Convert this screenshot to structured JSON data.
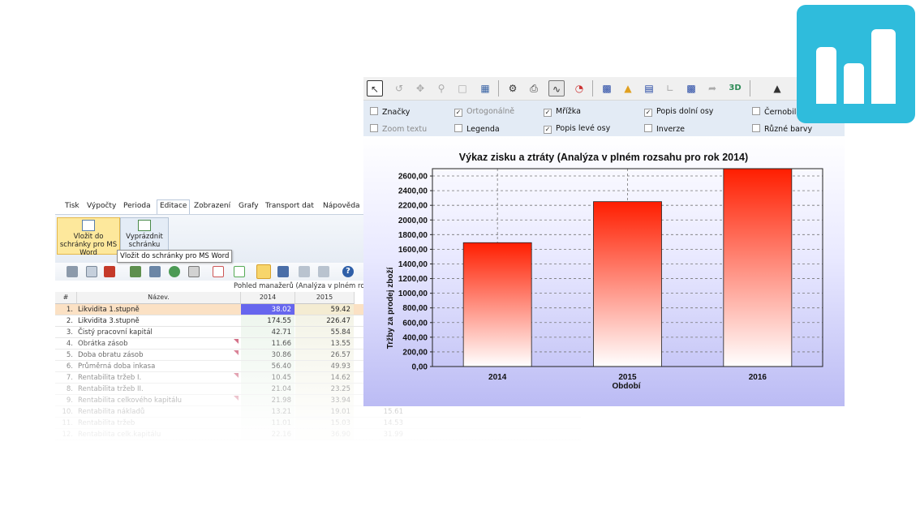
{
  "app": {
    "menu": [
      "Tisk",
      "Výpočty",
      "Perioda",
      "Editace",
      "Zobrazení",
      "Grafy",
      "Transport dat",
      "Nápověda"
    ],
    "ribbon": {
      "button1_label": "Vložit do schránky pro MS Word",
      "button2_label": "Vyprázdnit schránku"
    },
    "tooltip": "Vložit do schránky pro MS Word",
    "view_title": "Pohled manažerů (Analýza v plném rozsah",
    "table": {
      "headers": [
        "#",
        "Název.",
        "2014",
        "2015"
      ],
      "rows": [
        {
          "num": "1.",
          "name": "Likvidita 1.stupně",
          "v2014": "38.02",
          "v2015": "59.42",
          "v2016": ""
        },
        {
          "num": "2.",
          "name": "Likvidita 3.stupně",
          "v2014": "174.55",
          "v2015": "226.47",
          "v2016": ""
        },
        {
          "num": "3.",
          "name": "Čistý pracovní kapitál",
          "v2014": "42.71",
          "v2015": "55.84",
          "v2016": ""
        },
        {
          "num": "4.",
          "name": "Obrátka zásob",
          "v2014": "11.66",
          "v2015": "13.55",
          "v2016": ""
        },
        {
          "num": "5.",
          "name": "Doba obratu zásob",
          "v2014": "30.86",
          "v2015": "26.57",
          "v2016": ""
        },
        {
          "num": "6.",
          "name": "Průměrná doba inkasa",
          "v2014": "56.40",
          "v2015": "49.93",
          "v2016": ""
        },
        {
          "num": "7.",
          "name": "Rentabilita tržeb I.",
          "v2014": "10.45",
          "v2015": "14.62",
          "v2016": ""
        },
        {
          "num": "8.",
          "name": "Rentabilita tržeb II.",
          "v2014": "21.04",
          "v2015": "23.25",
          "v2016": ""
        },
        {
          "num": "9.",
          "name": "Rentabilita celkového kapitálu",
          "v2014": "21.98",
          "v2015": "33.94",
          "v2016": ""
        },
        {
          "num": "10.",
          "name": "Rentabilita nákladů",
          "v2014": "13.21",
          "v2015": "19.01",
          "v2016": "15.61"
        },
        {
          "num": "11.",
          "name": "Rentabilita tržeb",
          "v2014": "11.01",
          "v2015": "15.03",
          "v2016": "14.53"
        },
        {
          "num": "12.",
          "name": "Rentabilita celk.kapitálu",
          "v2014": "22.16",
          "v2015": "36.90",
          "v2016": "31.99"
        }
      ]
    }
  },
  "chart_window": {
    "options": {
      "znacky": "Značky",
      "ortogonalne": "Ortogonálně",
      "mrizka": "Mřížka",
      "popis_dolni": "Popis dolní osy",
      "cernobile": "Černobile",
      "zoom_textu": "Zoom textu",
      "legenda": "Legenda",
      "popis_leve": "Popis levé osy",
      "inverze": "Inverze",
      "ruzne_barvy": "Různé barvy"
    }
  },
  "chart_data": {
    "type": "bar",
    "title": "Výkaz zisku a ztráty (Analýza v plném rozsahu pro rok 2014)",
    "xlabel": "Období",
    "ylabel": "Tržby za prodej zboží",
    "categories": [
      "2014",
      "2015",
      "2016"
    ],
    "values": [
      1690,
      2250,
      2700
    ],
    "ylim": [
      0,
      2700
    ],
    "yticks": [
      "0,00",
      "200,00",
      "400,00",
      "600,00",
      "800,00",
      "1000,00",
      "1200,00",
      "1400,00",
      "1600,00",
      "1800,00",
      "2000,00",
      "2200,00",
      "2400,00",
      "2600,00"
    ],
    "grid": true,
    "colors": {
      "bar_top": "#ff1e00",
      "bar_bottom": "#ffffff",
      "bg_bottom": "#bbbbf4"
    }
  },
  "logo": {
    "icon": "bar-chart-icon",
    "color": "#2fbcdc"
  }
}
